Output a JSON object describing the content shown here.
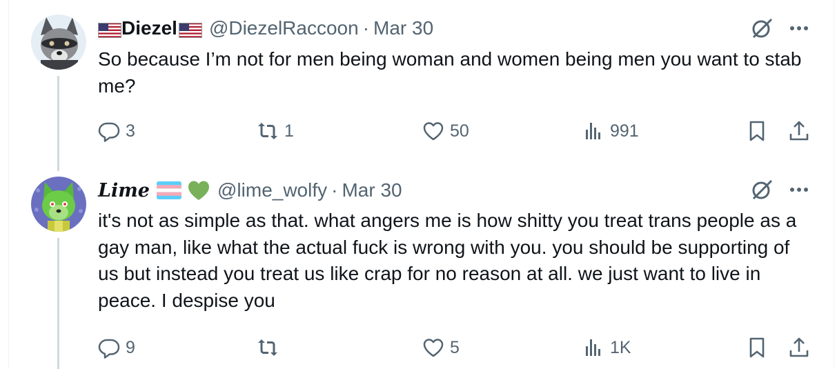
{
  "tweets": [
    {
      "name": "Diezel",
      "handle": "@DiezelRaccoon",
      "separator": "·",
      "date": "Mar 30",
      "text": "So because I’m not for men being woman and women being men you want to stab me?",
      "replies": "3",
      "reposts": "1",
      "likes": "50",
      "views": "991",
      "avatar_icon": "raccoon-avatar",
      "name_emoji": "us-flag"
    },
    {
      "name": "Lime",
      "handle": "@lime_wolfy",
      "separator": "·",
      "date": "Mar 30",
      "text": "it's not as simple as that. what angers me is how shitty you treat trans people as a gay man, like what the actual fuck is wrong with you. you should be supporting of us but instead you treat us like crap for no reason at all. we just want to live in peace. I despise you",
      "replies": "9",
      "reposts": "",
      "likes": "5",
      "views": "1K",
      "avatar_icon": "green-wolf-avatar",
      "name_emoji": "trans-flag, green-heart"
    }
  ],
  "colors": {
    "text": "#0f1419",
    "secondary": "#536471",
    "thread_line": "#cfd9de"
  }
}
